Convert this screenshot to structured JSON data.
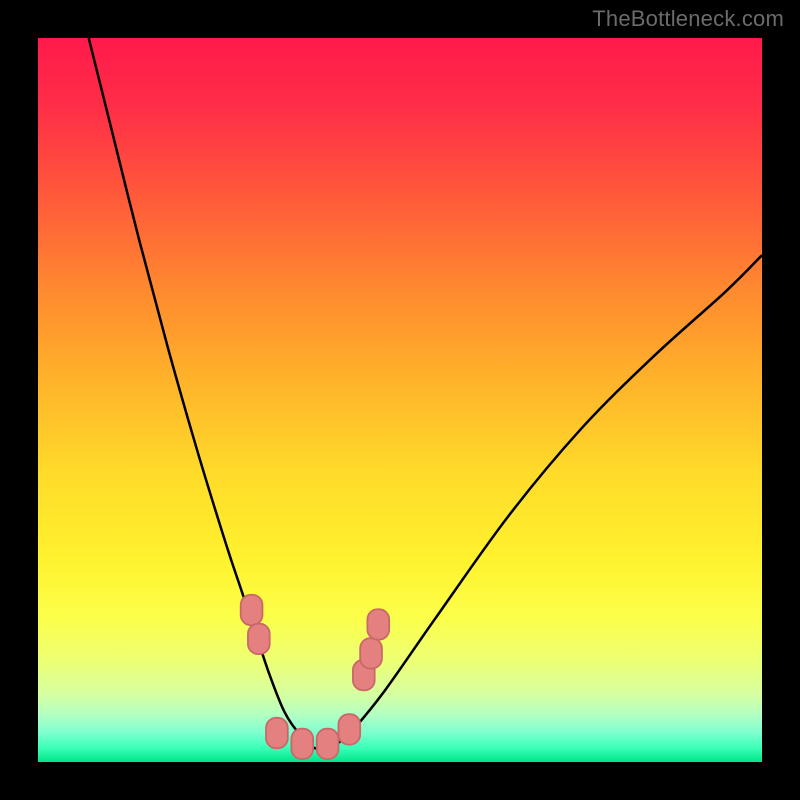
{
  "watermark": "TheBottleneck.com",
  "colors": {
    "frame": "#000000",
    "curve_stroke": "#000000",
    "marker_fill": "#e48080",
    "marker_stroke": "#c96868",
    "watermark": "#6b6b6b",
    "gradient_stops": [
      {
        "offset": 0.0,
        "color": "#ff1a4b"
      },
      {
        "offset": 0.1,
        "color": "#ff2f47"
      },
      {
        "offset": 0.22,
        "color": "#ff5a3a"
      },
      {
        "offset": 0.35,
        "color": "#ff8a2f"
      },
      {
        "offset": 0.48,
        "color": "#ffb52a"
      },
      {
        "offset": 0.6,
        "color": "#ffdb2a"
      },
      {
        "offset": 0.72,
        "color": "#fff22e"
      },
      {
        "offset": 0.8,
        "color": "#fcff4a"
      },
      {
        "offset": 0.86,
        "color": "#edff73"
      },
      {
        "offset": 0.905,
        "color": "#d7ffa0"
      },
      {
        "offset": 0.935,
        "color": "#b3ffc3"
      },
      {
        "offset": 0.96,
        "color": "#7cffcf"
      },
      {
        "offset": 0.98,
        "color": "#3cffb8"
      },
      {
        "offset": 1.0,
        "color": "#00e68a"
      }
    ]
  },
  "chart_data": {
    "type": "line",
    "title": "",
    "xlabel": "",
    "ylabel": "",
    "xlim": [
      0,
      100
    ],
    "ylim": [
      0,
      100
    ],
    "grid": false,
    "description": "Bottleneck-style V-curve on a red→green vertical gradient. Y encodes bottleneck severity (top=red=100%, bottom=green=0%). X is an unlabeled hardware-balance axis. One black curve dips from ~100% at x≈7 down to ~2% near x≈38 then rises to ~70% at x=100. Pink rounded markers cluster near the valley.",
    "series": [
      {
        "name": "bottleneck-curve",
        "x": [
          7,
          10,
          14,
          18,
          22,
          26,
          28,
          30,
          32,
          34,
          36,
          38,
          40,
          42,
          44,
          48,
          55,
          65,
          75,
          85,
          95,
          100
        ],
        "y": [
          100,
          88,
          72,
          57,
          43,
          30,
          24,
          18,
          12,
          7,
          4,
          2,
          2,
          3,
          5,
          10,
          20,
          34,
          46,
          56,
          65,
          70
        ]
      }
    ],
    "markers": [
      {
        "x": 29.5,
        "y": 21
      },
      {
        "x": 30.5,
        "y": 17
      },
      {
        "x": 33.0,
        "y": 4
      },
      {
        "x": 36.5,
        "y": 2.5
      },
      {
        "x": 40.0,
        "y": 2.5
      },
      {
        "x": 43.0,
        "y": 4.5
      },
      {
        "x": 45.0,
        "y": 12
      },
      {
        "x": 46.0,
        "y": 15
      },
      {
        "x": 47.0,
        "y": 19
      }
    ]
  }
}
